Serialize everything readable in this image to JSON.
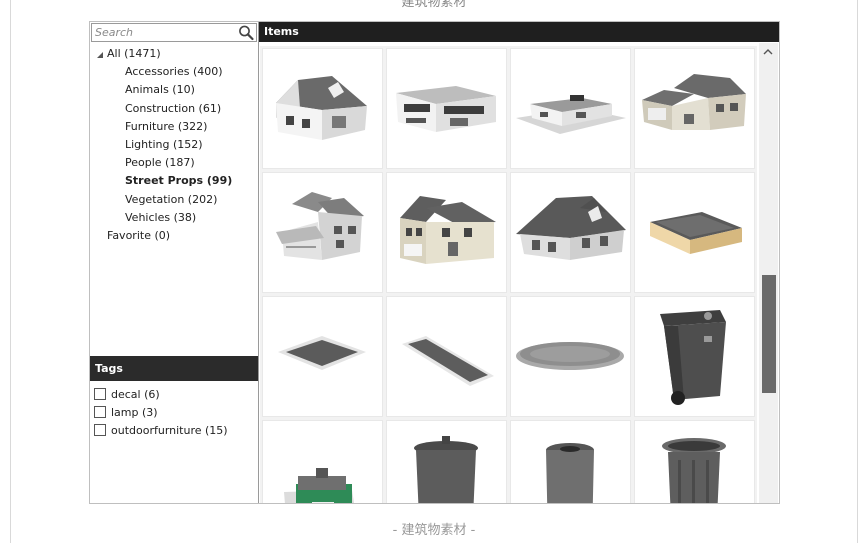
{
  "page": {
    "top_caption": "建筑物素材",
    "bottom_caption": "- 建筑物素材 -"
  },
  "search": {
    "placeholder": "Search",
    "value": ""
  },
  "tree": {
    "all_label": "All (1471)",
    "categories": [
      {
        "label": "Accessories (400)",
        "selected": false
      },
      {
        "label": "Animals (10)",
        "selected": false
      },
      {
        "label": "Construction (61)",
        "selected": false
      },
      {
        "label": "Furniture (322)",
        "selected": false
      },
      {
        "label": "Lighting (152)",
        "selected": false
      },
      {
        "label": "People (187)",
        "selected": false
      },
      {
        "label": "Street Props (99)",
        "selected": true
      },
      {
        "label": "Vegetation (202)",
        "selected": false
      },
      {
        "label": "Vehicles (38)",
        "selected": false
      }
    ],
    "favorite_label": "Favorite (0)"
  },
  "tags": {
    "header": "Tags",
    "items": [
      {
        "label": "decal (6)",
        "checked": false
      },
      {
        "label": "lamp (3)",
        "checked": false
      },
      {
        "label": "outdoorfurniture (15)",
        "checked": false
      }
    ]
  },
  "items": {
    "header": "Items",
    "thumbnails": [
      "house-gable-icon",
      "house-modern-icon",
      "house-flat-icon",
      "house-large-icon",
      "house-porch-icon",
      "house-twostory-icon",
      "house-roof-icon",
      "planter-box-icon",
      "dirt-patch-icon",
      "dirt-strip-icon",
      "round-patch-icon",
      "wheelie-bin-icon",
      "recycle-bin-icon",
      "trash-can-icon",
      "trash-can-small-icon",
      "trash-can-ornate-icon"
    ]
  }
}
